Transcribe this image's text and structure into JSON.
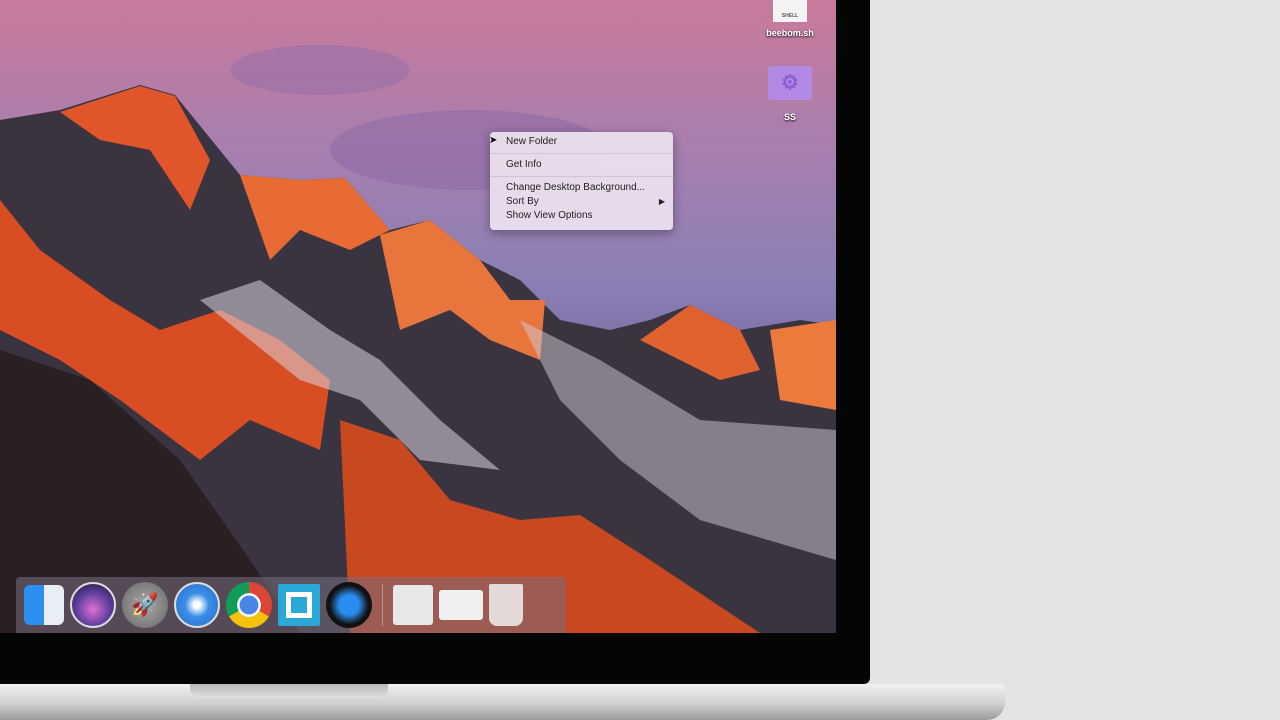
{
  "desktop_icons": [
    {
      "label": "beebom.sh",
      "badge": "SHELL",
      "icon": "shell-script-icon"
    },
    {
      "label": "SS",
      "icon": "folder-icon"
    }
  ],
  "context_menu": {
    "items": [
      {
        "label": "New Folder"
      },
      {
        "label": "Get Info"
      },
      {
        "label": "Change Desktop Background..."
      },
      {
        "label": "Sort By",
        "submenu": true
      },
      {
        "label": "Show View Options"
      }
    ],
    "submenu_arrow": "▶"
  },
  "dock": {
    "apps": [
      "finder-icon",
      "siri-icon",
      "launchpad-icon",
      "safari-icon",
      "chrome-icon",
      "quickview-icon",
      "quicktime-icon"
    ],
    "others": [
      "documents-stack-icon",
      "screenshots-stack-icon",
      "trash-icon"
    ]
  }
}
